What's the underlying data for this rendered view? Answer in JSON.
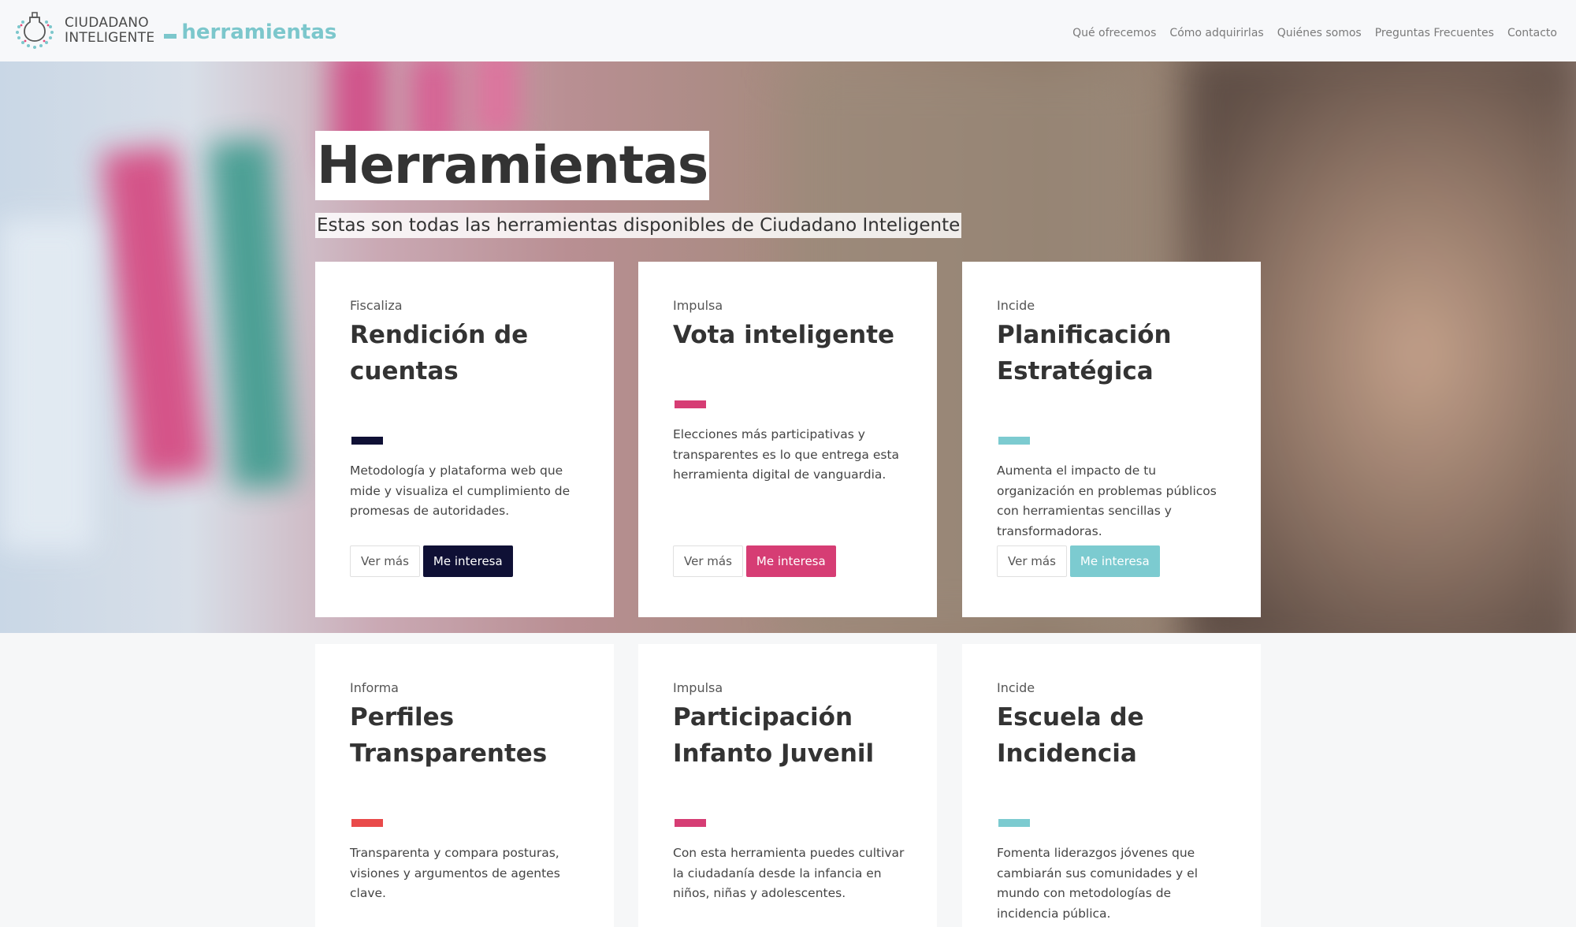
{
  "header": {
    "org_line1": "CIUDADANO",
    "org_line2": "INTELIGENTE",
    "product": "herramientas",
    "nav": [
      "Qué ofrecemos",
      "Cómo adquirirlas",
      "Quiénes somos",
      "Preguntas Frecuentes",
      "Contacto"
    ]
  },
  "hero": {
    "title": "Herramientas",
    "subtitle": "Estas son todas las herramientas disponibles de Ciudadano Inteligente"
  },
  "cards": [
    {
      "category": "Fiscaliza",
      "title": "Rendición de cuentas",
      "description": "Metodología y plataforma web que mide y visualiza el cumplimiento de promesas de autoridades.",
      "more_label": "Ver más",
      "interest_label": "Me interesa",
      "accent": "#0f1035"
    },
    {
      "category": "Impulsa",
      "title": "Vota inteligente",
      "description": "Elecciones más participativas y transparentes es lo que entrega esta herramienta digital de vanguardia.",
      "more_label": "Ver más",
      "interest_label": "Me interesa",
      "accent": "#d63d74"
    },
    {
      "category": "Incide",
      "title": "Planificación Estratégica",
      "description": "Aumenta el impacto de tu organización en problemas públicos con herramientas sencillas y transformadoras.",
      "more_label": "Ver más",
      "interest_label": "Me interesa",
      "accent": "#7ccbd0"
    },
    {
      "category": "Informa",
      "title": "Perfiles Transparentes",
      "description": "Transparenta y compara posturas, visiones y argumentos de agentes clave.",
      "accent": "#e94a4a"
    },
    {
      "category": "Impulsa",
      "title": "Participación Infanto Juvenil",
      "description": "Con esta herramienta puedes cultivar la ciudadanía desde la infancia en niños, niñas y adolescentes.",
      "accent": "#d63d74"
    },
    {
      "category": "Incide",
      "title": "Escuela de Incidencia",
      "description": "Fomenta liderazgos jóvenes que cambiarán sus comunidades y el mundo con metodologías de incidencia pública.",
      "accent": "#7ccbd0"
    }
  ]
}
